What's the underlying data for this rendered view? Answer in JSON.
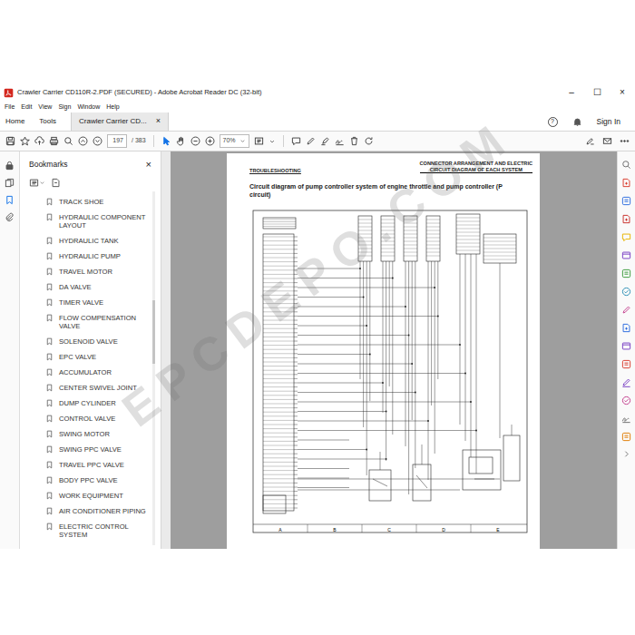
{
  "window": {
    "title": "Crawler Carrier CD110R-2.PDF (SECURED) - Adobe Acrobat Reader DC (32-bit)",
    "controls": [
      "–",
      "☐",
      "×"
    ]
  },
  "menu": [
    "File",
    "Edit",
    "View",
    "Sign",
    "Window",
    "Help"
  ],
  "tabs": [
    {
      "label": "Home",
      "selected": false
    },
    {
      "label": "Tools",
      "selected": false
    },
    {
      "label": "Crawler Carrier CD...",
      "selected": true
    }
  ],
  "tab_close": "×",
  "account": {
    "help": "?",
    "sign_in": "Sign In"
  },
  "toolbar": {
    "page": "197",
    "page_total": "/ 383",
    "zoom": "70%",
    "tools": [
      {
        "selected": true
      },
      {
        "selected": false
      }
    ]
  },
  "left_rail": [
    {
      "selected": false
    },
    {
      "selected": false
    },
    {
      "selected": true
    },
    {
      "selected": false
    }
  ],
  "bookmarks": {
    "title": "Bookmarks",
    "close": "×",
    "items": [
      "TRACK SHOE",
      "HYDRAULIC COMPONENT LAYOUT",
      "HYDRAULIC TANK",
      "HYDRAULIC PUMP",
      "TRAVEL MOTOR",
      "DA VALVE",
      "TIMER VALVE",
      "FLOW COMPENSATION VALVE",
      "SOLENOID VALVE",
      "EPC VALVE",
      "ACCUMULATOR",
      "CENTER SWIVEL JOINT",
      "DUMP CYLINDER",
      "CONTROL VALVE",
      "SWING MOTOR",
      "SWING PPC VALVE",
      "TRAVEL PPC VALVE",
      "BODY PPC VALVE",
      "WORK EQUIPMENT",
      "AIR CONDITIONER PIPING",
      "ELECTRIC CONTROL SYSTEM"
    ]
  },
  "document": {
    "header_left": "TROUBLESHOOTING",
    "header_right": [
      "CONNECTOR ARRANGEMENT AND ELECTRIC",
      "CIRCUIT DIAGRAM OF EACH SYSTEM"
    ],
    "title": "Circuit diagram of pump controller system of engine throttle and pump controller (P circuit)",
    "grid_labels": [
      "A",
      "B",
      "C",
      "D",
      "E"
    ],
    "watermark": "EPCDEPO.COM"
  },
  "right_rail": [
    {
      "color": "#6d6d6d"
    },
    {
      "color": "#d83b2e"
    },
    {
      "color": "#2d6cdf"
    },
    {
      "color": "#c9302c"
    },
    {
      "color": "#e8b400"
    },
    {
      "color": "#7a3fc4"
    },
    {
      "color": "#3a9a3a"
    },
    {
      "color": "#2d8fb5"
    },
    {
      "color": "#c43f8e"
    },
    {
      "color": "#2d6cdf"
    },
    {
      "color": "#7a3fc4"
    },
    {
      "color": "#d83b2e"
    },
    {
      "color": "#7a3fc4"
    },
    {
      "color": "#c43f8e"
    },
    {
      "color": "#6d6d6d"
    },
    {
      "color": "#e07b00"
    }
  ]
}
